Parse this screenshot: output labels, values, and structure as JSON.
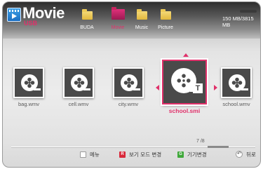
{
  "header": {
    "title": "Movie",
    "source": "USB",
    "capacity": "150 MB/3815 MB"
  },
  "categories": [
    {
      "label": "BUDA"
    },
    {
      "label": "Movie",
      "selected": true
    },
    {
      "label": "Music"
    },
    {
      "label": "Picture"
    }
  ],
  "files": [
    {
      "label": "bag.wmv"
    },
    {
      "label": "cell.wmv"
    },
    {
      "label": "city.wmv"
    },
    {
      "label": "school.smi",
      "focused": true,
      "badge": "T"
    },
    {
      "label": "school.wmv"
    }
  ],
  "pagination": "7 /8",
  "footer": {
    "menu": "메뉴",
    "view_mode": "보기 모드 변경",
    "view_mode_key": "R",
    "device": "기기변경",
    "device_key": "G",
    "back": "뒤로"
  },
  "colors": {
    "accent": "#e0306a",
    "red_key": "#d8283a",
    "green_key": "#3fa83a"
  },
  "icons": {
    "app": "movie-app-icon",
    "folder": "folder-icon",
    "file": "film-reel-icon",
    "subtitle": "subtitle-t-icon"
  }
}
